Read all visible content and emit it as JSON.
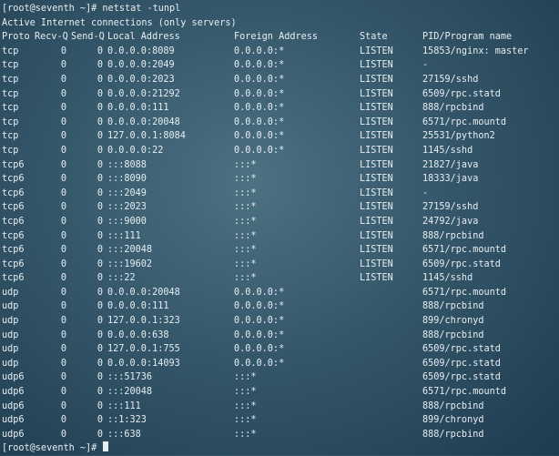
{
  "prompt": "[root@seventh ~]#",
  "command": "netstat -tunpl",
  "banner": "Active Internet connections (only servers)",
  "columns": {
    "proto": "Proto",
    "recvq": "Recv-Q",
    "sendq": "Send-Q",
    "local": "Local Address",
    "foreign": "Foreign Address",
    "state": "State",
    "pid": "PID/Program name"
  },
  "rows": [
    {
      "proto": "tcp",
      "recvq": "0",
      "sendq": "0",
      "local": "0.0.0.0:8089",
      "foreign": "0.0.0.0:*",
      "state": "LISTEN",
      "pid": "15853/nginx: master"
    },
    {
      "proto": "tcp",
      "recvq": "0",
      "sendq": "0",
      "local": "0.0.0.0:2049",
      "foreign": "0.0.0.0:*",
      "state": "LISTEN",
      "pid": "-"
    },
    {
      "proto": "tcp",
      "recvq": "0",
      "sendq": "0",
      "local": "0.0.0.0:2023",
      "foreign": "0.0.0.0:*",
      "state": "LISTEN",
      "pid": "27159/sshd"
    },
    {
      "proto": "tcp",
      "recvq": "0",
      "sendq": "0",
      "local": "0.0.0.0:21292",
      "foreign": "0.0.0.0:*",
      "state": "LISTEN",
      "pid": "6509/rpc.statd"
    },
    {
      "proto": "tcp",
      "recvq": "0",
      "sendq": "0",
      "local": "0.0.0.0:111",
      "foreign": "0.0.0.0:*",
      "state": "LISTEN",
      "pid": "888/rpcbind"
    },
    {
      "proto": "tcp",
      "recvq": "0",
      "sendq": "0",
      "local": "0.0.0.0:20048",
      "foreign": "0.0.0.0:*",
      "state": "LISTEN",
      "pid": "6571/rpc.mountd"
    },
    {
      "proto": "tcp",
      "recvq": "0",
      "sendq": "0",
      "local": "127.0.0.1:8084",
      "foreign": "0.0.0.0:*",
      "state": "LISTEN",
      "pid": "25531/python2"
    },
    {
      "proto": "tcp",
      "recvq": "0",
      "sendq": "0",
      "local": "0.0.0.0:22",
      "foreign": "0.0.0.0:*",
      "state": "LISTEN",
      "pid": "1145/sshd"
    },
    {
      "proto": "tcp6",
      "recvq": "0",
      "sendq": "0",
      "local": ":::8088",
      "foreign": ":::*",
      "state": "LISTEN",
      "pid": "21827/java"
    },
    {
      "proto": "tcp6",
      "recvq": "0",
      "sendq": "0",
      "local": ":::8090",
      "foreign": ":::*",
      "state": "LISTEN",
      "pid": "18333/java"
    },
    {
      "proto": "tcp6",
      "recvq": "0",
      "sendq": "0",
      "local": ":::2049",
      "foreign": ":::*",
      "state": "LISTEN",
      "pid": "-"
    },
    {
      "proto": "tcp6",
      "recvq": "0",
      "sendq": "0",
      "local": ":::2023",
      "foreign": ":::*",
      "state": "LISTEN",
      "pid": "27159/sshd"
    },
    {
      "proto": "tcp6",
      "recvq": "0",
      "sendq": "0",
      "local": ":::9000",
      "foreign": ":::*",
      "state": "LISTEN",
      "pid": "24792/java"
    },
    {
      "proto": "tcp6",
      "recvq": "0",
      "sendq": "0",
      "local": ":::111",
      "foreign": ":::*",
      "state": "LISTEN",
      "pid": "888/rpcbind"
    },
    {
      "proto": "tcp6",
      "recvq": "0",
      "sendq": "0",
      "local": ":::20048",
      "foreign": ":::*",
      "state": "LISTEN",
      "pid": "6571/rpc.mountd"
    },
    {
      "proto": "tcp6",
      "recvq": "0",
      "sendq": "0",
      "local": ":::19602",
      "foreign": ":::*",
      "state": "LISTEN",
      "pid": "6509/rpc.statd"
    },
    {
      "proto": "tcp6",
      "recvq": "0",
      "sendq": "0",
      "local": ":::22",
      "foreign": ":::*",
      "state": "LISTEN",
      "pid": "1145/sshd"
    },
    {
      "proto": "udp",
      "recvq": "0",
      "sendq": "0",
      "local": "0.0.0.0:20048",
      "foreign": "0.0.0.0:*",
      "state": "",
      "pid": "6571/rpc.mountd"
    },
    {
      "proto": "udp",
      "recvq": "0",
      "sendq": "0",
      "local": "0.0.0.0:111",
      "foreign": "0.0.0.0:*",
      "state": "",
      "pid": "888/rpcbind"
    },
    {
      "proto": "udp",
      "recvq": "0",
      "sendq": "0",
      "local": "127.0.0.1:323",
      "foreign": "0.0.0.0:*",
      "state": "",
      "pid": "899/chronyd"
    },
    {
      "proto": "udp",
      "recvq": "0",
      "sendq": "0",
      "local": "0.0.0.0:638",
      "foreign": "0.0.0.0:*",
      "state": "",
      "pid": "888/rpcbind"
    },
    {
      "proto": "udp",
      "recvq": "0",
      "sendq": "0",
      "local": "127.0.0.1:755",
      "foreign": "0.0.0.0:*",
      "state": "",
      "pid": "6509/rpc.statd"
    },
    {
      "proto": "udp",
      "recvq": "0",
      "sendq": "0",
      "local": "0.0.0.0:14093",
      "foreign": "0.0.0.0:*",
      "state": "",
      "pid": "6509/rpc.statd"
    },
    {
      "proto": "udp6",
      "recvq": "0",
      "sendq": "0",
      "local": ":::51736",
      "foreign": ":::*",
      "state": "",
      "pid": "6509/rpc.statd"
    },
    {
      "proto": "udp6",
      "recvq": "0",
      "sendq": "0",
      "local": ":::20048",
      "foreign": ":::*",
      "state": "",
      "pid": "6571/rpc.mountd"
    },
    {
      "proto": "udp6",
      "recvq": "0",
      "sendq": "0",
      "local": ":::111",
      "foreign": ":::*",
      "state": "",
      "pid": "888/rpcbind"
    },
    {
      "proto": "udp6",
      "recvq": "0",
      "sendq": "0",
      "local": "::1:323",
      "foreign": ":::*",
      "state": "",
      "pid": "899/chronyd"
    },
    {
      "proto": "udp6",
      "recvq": "0",
      "sendq": "0",
      "local": ":::638",
      "foreign": ":::*",
      "state": "",
      "pid": "888/rpcbind"
    }
  ]
}
